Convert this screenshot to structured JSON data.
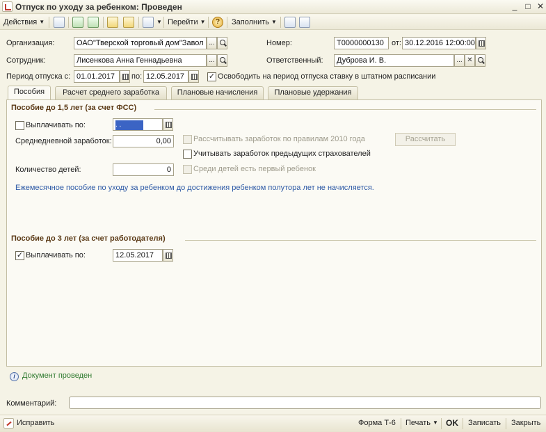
{
  "window": {
    "title": "Отпуск по уходу за ребенком: Проведен",
    "controls": {
      "minimize": "_",
      "maximize": "□",
      "close": "✕"
    }
  },
  "toolbar": {
    "actions": "Действия",
    "goto": "Перейти",
    "help": "?",
    "fill": "Заполнить"
  },
  "header": {
    "organization_label": "Организация:",
    "organization_value": "ОАО\"Тверской торговый дом\"Завол",
    "number_label": "Номер:",
    "number_value": "Т0000000130",
    "date_label": "от:",
    "date_value": "30.12.2016 12:00:00",
    "employee_label": "Сотрудник:",
    "employee_value": "Лисенкова Анна Геннадьевна",
    "responsible_label": "Ответственный:",
    "responsible_value": "Дуброва И. В.",
    "period_label": "Период отпуска с:",
    "period_from": "01.01.2017",
    "period_to_label": "по:",
    "period_to": "12.05.2017",
    "release_rate_label": "Освободить на период отпуска ставку в штатном расписании",
    "release_rate_checked": true
  },
  "tabs": [
    {
      "label": "Пособия",
      "active": true
    },
    {
      "label": "Расчет среднего заработка",
      "active": false
    },
    {
      "label": "Плановые начисления",
      "active": false
    },
    {
      "label": "Плановые удержания",
      "active": false
    }
  ],
  "section1": {
    "title": "Пособие до 1,5 лет (за счет ФСС)",
    "pay_until_label": "Выплачивать по:",
    "pay_until_checked": false,
    "pay_until_value": " .  .",
    "avg_earnings_label": "Среднедневной заработок:",
    "avg_earnings_value": "0,00",
    "rules_2010_label": "Рассчитывать заработок по правилам 2010 года",
    "calculate_button": "Рассчитать",
    "prev_insurers_label": "Учитывать заработок предыдущих страхователей",
    "children_count_label": "Количество детей:",
    "children_count_value": "0",
    "first_child_label": "Среди детей есть первый ребенок",
    "info_text": "Ежемесячное пособие по уходу за ребенком до достижения ребенком полутора лет не начисляется."
  },
  "section2": {
    "title": "Пособие до 3 лет (за счет работодателя)",
    "pay_until_label": "Выплачивать по:",
    "pay_until_checked": true,
    "pay_until_value": "12.05.2017"
  },
  "status": {
    "text": "Документ проведен"
  },
  "comment": {
    "label": "Комментарий:",
    "value": ""
  },
  "bottom": {
    "fix": "Исправить",
    "form_t6": "Форма Т-6",
    "print": "Печать",
    "ok": "OK",
    "save": "Записать",
    "close": "Закрыть"
  }
}
